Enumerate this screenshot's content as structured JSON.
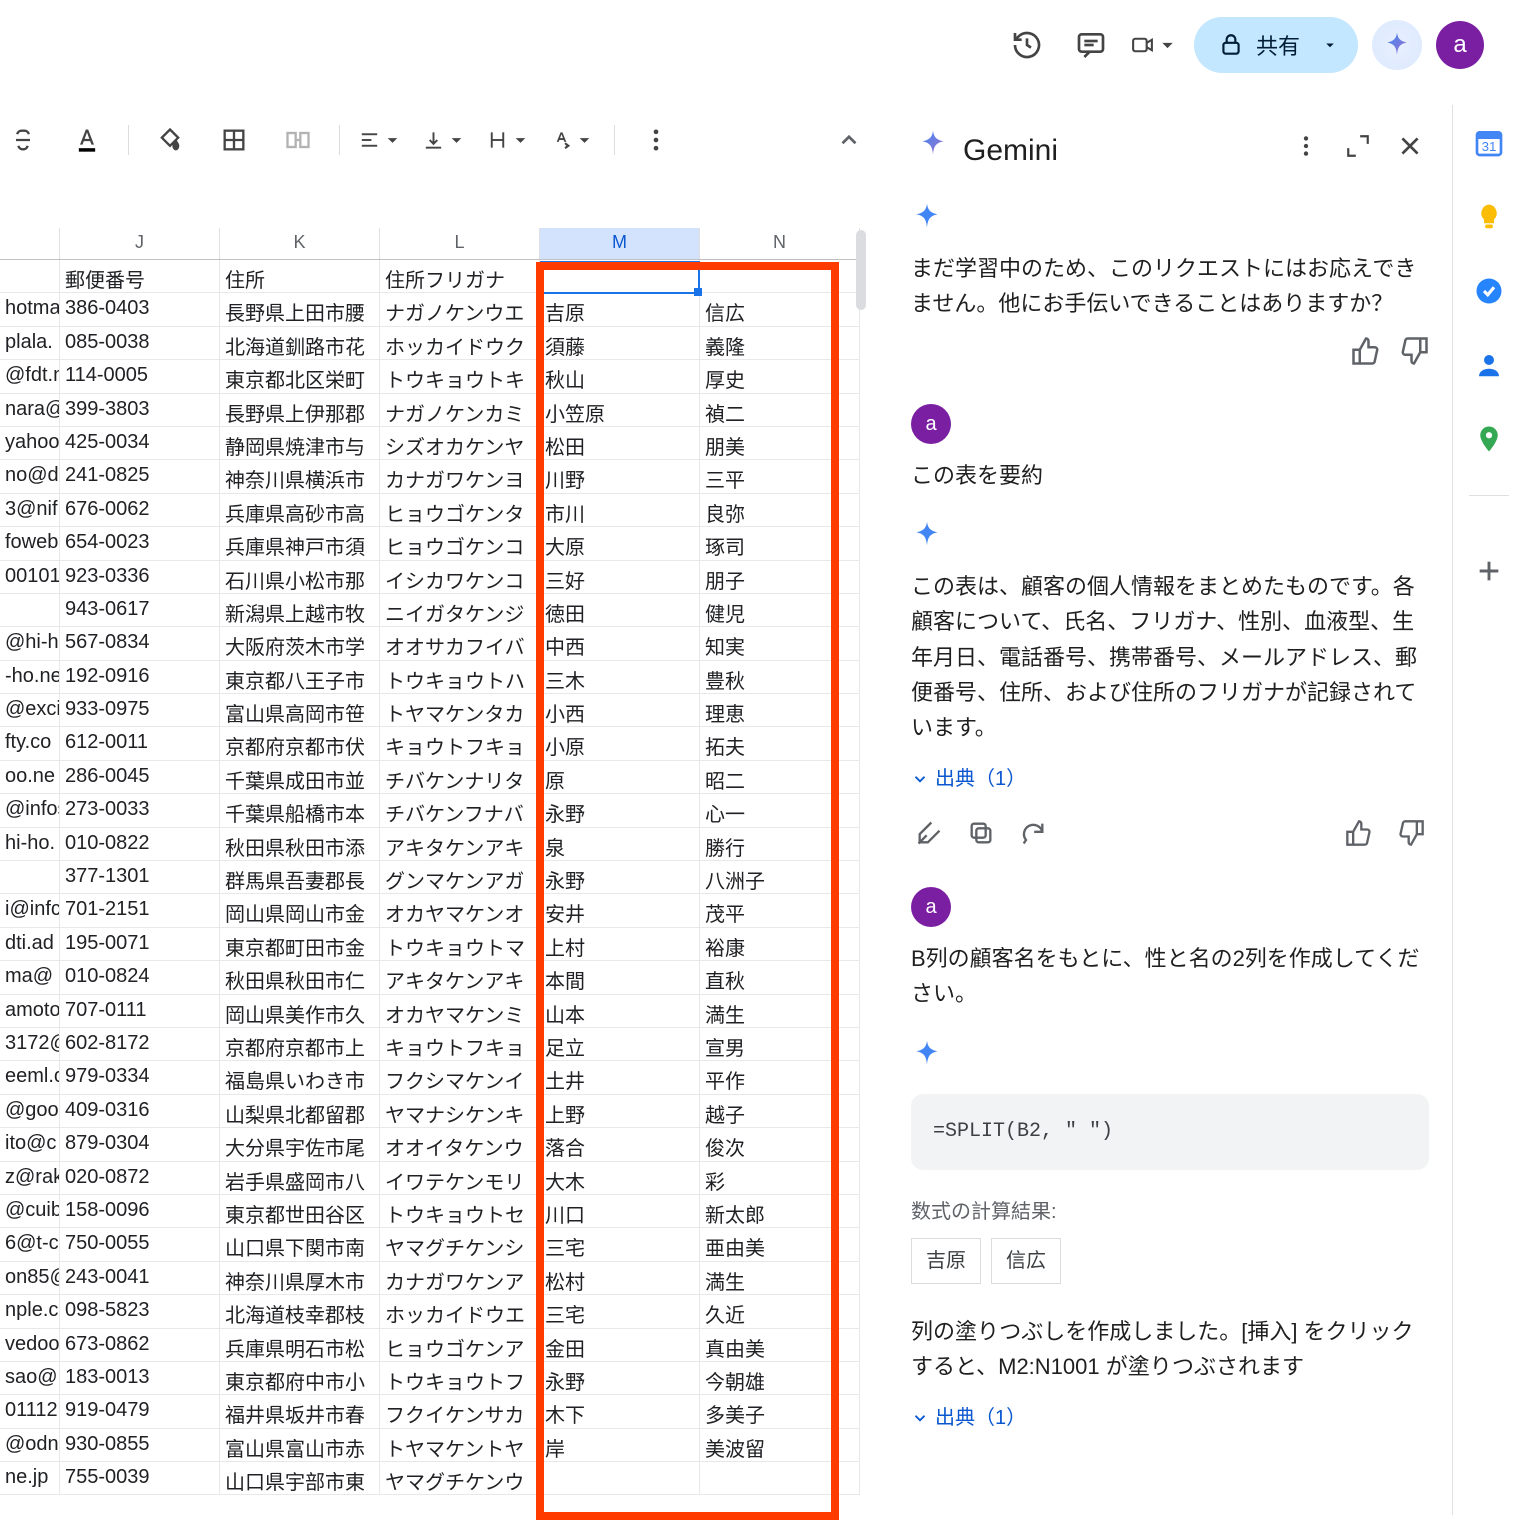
{
  "header": {
    "share_label": "共有",
    "avatar_letter": "a"
  },
  "panel": {
    "title": "Gemini",
    "cannot_text": "まだ学習中のため、このリクエストにはお応えできません。他にお手伝いできることはありますか？",
    "user_prompt_1": "この表を要約",
    "summary_text": "この表は、顧客の個人情報をまとめたものです。各顧客について、氏名、フリガナ、性別、血液型、生年月日、電話番号、携帯番号、メールアドレス、郵便番号、住所、および住所のフリガナが記録されています。",
    "source_1": "出典（1）",
    "user_prompt_2": "B列の顧客名をもとに、性と名の2列を作成してください。",
    "formula": "=SPLIT(B2, \" \")",
    "calc_label": "数式の計算結果:",
    "chip_1": "吉原",
    "chip_2": "信広",
    "fill_text": "列の塗りつぶしを作成しました。[挿入] をクリックすると、M2:N1001 が塗りつぶされます",
    "source_2": "出典（1）",
    "avatar_letter": "a"
  },
  "sheet": {
    "col_headers": {
      "I": "",
      "J": "J",
      "K": "K",
      "L": "L",
      "M": "M",
      "N": "N"
    },
    "header_row": {
      "J": "郵便番号",
      "K": "住所",
      "L": "住所フリガナ",
      "M": "",
      "N": ""
    },
    "rows": [
      {
        "I": "hotma",
        "J": "386-0403",
        "K": "長野県上田市腰",
        "L": "ナガノケンウエ",
        "M": "吉原",
        "N": "信広"
      },
      {
        "I": "plala.",
        "J": "085-0038",
        "K": "北海道釧路市花",
        "L": "ホッカイドウク",
        "M": "須藤",
        "N": "義隆"
      },
      {
        "I": "@fdt.n",
        "J": "114-0005",
        "K": "東京都北区栄町",
        "L": "トウキョウトキ",
        "M": "秋山",
        "N": "厚史"
      },
      {
        "I": "nara@",
        "J": "399-3803",
        "K": "長野県上伊那郡",
        "L": "ナガノケンカミ",
        "M": "小笠原",
        "N": "禎二"
      },
      {
        "I": "yahoo",
        "J": "425-0034",
        "K": "静岡県焼津市与",
        "L": "シズオカケンヤ",
        "M": "松田",
        "N": "朋美"
      },
      {
        "I": "no@d",
        "J": "241-0825",
        "K": "神奈川県横浜市",
        "L": "カナガワケンヨ",
        "M": "川野",
        "N": "三平"
      },
      {
        "I": "3@nif",
        "J": "676-0062",
        "K": "兵庫県高砂市高",
        "L": "ヒョウゴケンタ",
        "M": "市川",
        "N": "良弥"
      },
      {
        "I": "foweb",
        "J": "654-0023",
        "K": "兵庫県神戸市須",
        "L": "ヒョウゴケンコ",
        "M": "大原",
        "N": "琢司"
      },
      {
        "I": "00101",
        "J": "923-0336",
        "K": "石川県小松市那",
        "L": "イシカワケンコ",
        "M": "三好",
        "N": "朋子"
      },
      {
        "I": "",
        "J": "943-0617",
        "K": "新潟県上越市牧",
        "L": "ニイガタケンジ",
        "M": "徳田",
        "N": "健児"
      },
      {
        "I": "@hi-ho",
        "J": "567-0834",
        "K": "大阪府茨木市学",
        "L": "オオサカフイバ",
        "M": "中西",
        "N": "知実"
      },
      {
        "I": "-ho.ne",
        "J": "192-0916",
        "K": "東京都八王子市",
        "L": "トウキョウトハ",
        "M": "三木",
        "N": "豊秋"
      },
      {
        "I": "@excit",
        "J": "933-0975",
        "K": "富山県高岡市笹",
        "L": "トヤマケンタカ",
        "M": "小西",
        "N": "理恵"
      },
      {
        "I": "fty.co",
        "J": "612-0011",
        "K": "京都府京都市伏",
        "L": "キョウトフキョ",
        "M": "小原",
        "N": "拓夫"
      },
      {
        "I": "oo.ne",
        "J": "286-0045",
        "K": "千葉県成田市並",
        "L": "チバケンナリタ",
        "M": "原",
        "N": "昭二"
      },
      {
        "I": "@infos",
        "J": "273-0033",
        "K": "千葉県船橋市本",
        "L": "チバケンフナバ",
        "M": "永野",
        "N": "心一"
      },
      {
        "I": "hi-ho.",
        "J": "010-0822",
        "K": "秋田県秋田市添",
        "L": "アキタケンアキ",
        "M": "泉",
        "N": "勝行"
      },
      {
        "I": "",
        "J": "377-1301",
        "K": "群馬県吾妻郡長",
        "L": "グンマケンアガ",
        "M": "永野",
        "N": "八洲子"
      },
      {
        "I": "i@infc",
        "J": "701-2151",
        "K": "岡山県岡山市金",
        "L": "オカヤマケンオ",
        "M": "安井",
        "N": "茂平"
      },
      {
        "I": "dti.ad",
        "J": "195-0071",
        "K": "東京都町田市金",
        "L": "トウキョウトマ",
        "M": "上村",
        "N": "裕康"
      },
      {
        "I": "ma@",
        "J": "010-0824",
        "K": "秋田県秋田市仁",
        "L": "アキタケンアキ",
        "M": "本間",
        "N": "直秋"
      },
      {
        "I": "amoto",
        "J": "707-0111",
        "K": "岡山県美作市久",
        "L": "オカヤマケンミ",
        "M": "山本",
        "N": "満生"
      },
      {
        "I": "3172@",
        "J": "602-8172",
        "K": "京都府京都市上",
        "L": "キョウトフキョ",
        "M": "足立",
        "N": "宣男"
      },
      {
        "I": "eeml.c",
        "J": "979-0334",
        "K": "福島県いわき市",
        "L": "フクシマケンイ",
        "M": "土井",
        "N": "平作"
      },
      {
        "I": "@goo.",
        "J": "409-0316",
        "K": "山梨県北都留郡",
        "L": "ヤマナシケンキ",
        "M": "上野",
        "N": "越子"
      },
      {
        "I": "ito@c",
        "J": "879-0304",
        "K": "大分県宇佐市尾",
        "L": "オオイタケンウ",
        "M": "落合",
        "N": "俊次"
      },
      {
        "I": "z@rak",
        "J": "020-0872",
        "K": "岩手県盛岡市八",
        "L": "イワテケンモリ",
        "M": "大木",
        "N": "彩"
      },
      {
        "I": "@cuib",
        "J": "158-0096",
        "K": "東京都世田谷区",
        "L": "トウキョウトセ",
        "M": "川口",
        "N": "新太郎"
      },
      {
        "I": "6@t-c",
        "J": "750-0055",
        "K": "山口県下関市南",
        "L": "ヤマグチケンシ",
        "M": "三宅",
        "N": "亜由美"
      },
      {
        "I": "on85@",
        "J": "243-0041",
        "K": "神奈川県厚木市",
        "L": "カナガワケンア",
        "M": "松村",
        "N": "満生"
      },
      {
        "I": "nple.c",
        "J": "098-5823",
        "K": "北海道枝幸郡枝",
        "L": "ホッカイドウエ",
        "M": "三宅",
        "N": "久近"
      },
      {
        "I": "vedoo",
        "J": "673-0862",
        "K": "兵庫県明石市松",
        "L": "ヒョウゴケンア",
        "M": "金田",
        "N": "真由美"
      },
      {
        "I": "sao@",
        "J": "183-0013",
        "K": "東京都府中市小",
        "L": "トウキョウトフ",
        "M": "永野",
        "N": "今朝雄"
      },
      {
        "I": "01112",
        "J": "919-0479",
        "K": "福井県坂井市春",
        "L": "フクイケンサカ",
        "M": "木下",
        "N": "多美子"
      },
      {
        "I": "@odn",
        "J": "930-0855",
        "K": "富山県富山市赤",
        "L": "トヤマケントヤ",
        "M": "岸",
        "N": "美波留"
      },
      {
        "I": "ne.jp",
        "J": "755-0039",
        "K": "山口県宇部市東",
        "L": "ヤマグチケンウ",
        "M": "",
        "N": ""
      }
    ]
  }
}
